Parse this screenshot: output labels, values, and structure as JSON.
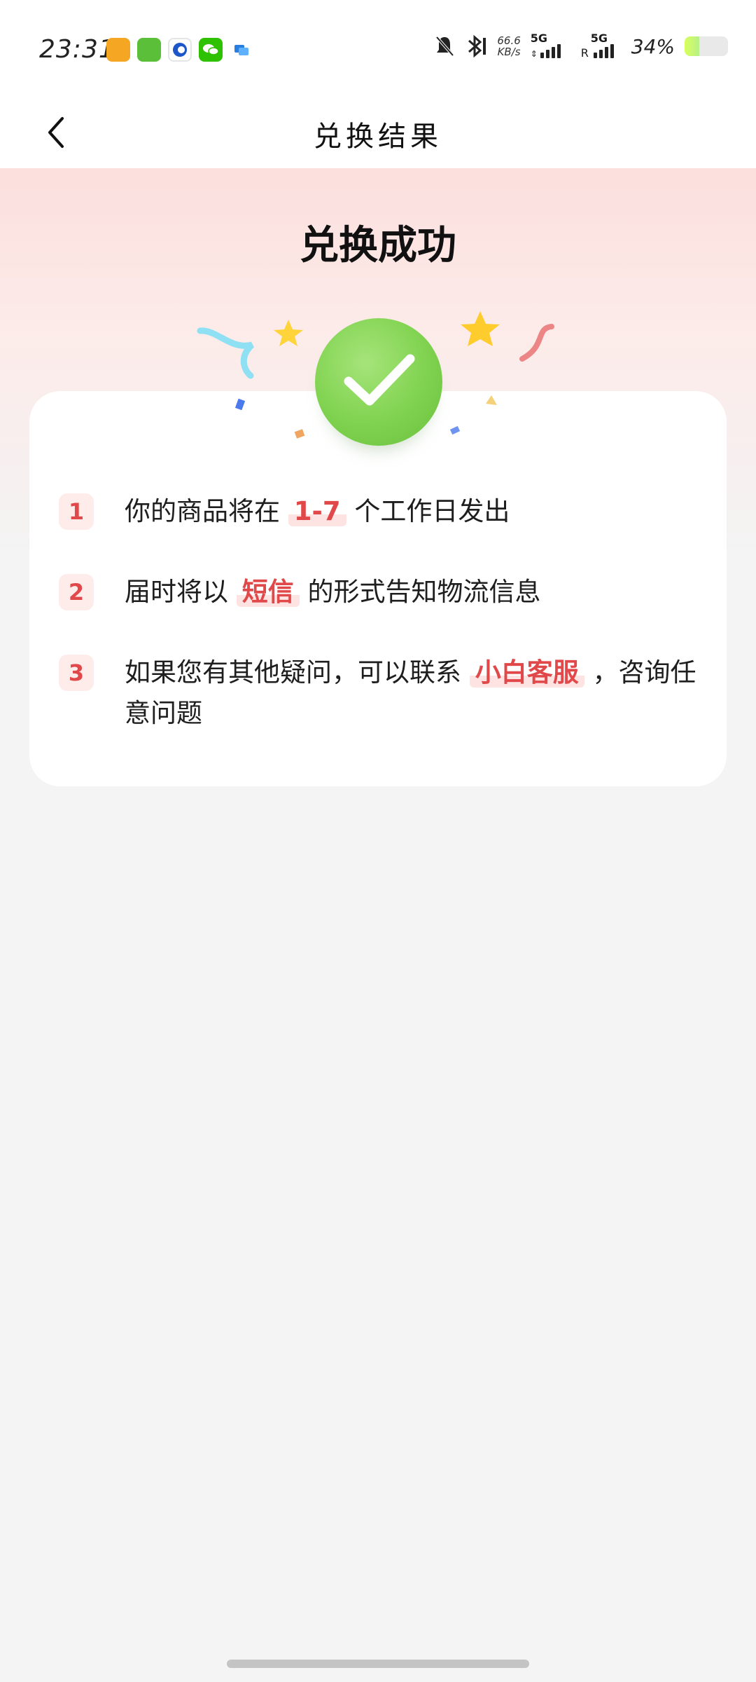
{
  "status_bar": {
    "time": "23:31",
    "net_speed_value": "66.6",
    "net_speed_unit": "KB/s",
    "signal1_label": "5G",
    "signal2_label": "5G",
    "signal2_roaming": "R",
    "battery_percent": "34%",
    "battery_level": 0.34,
    "app_icons": [
      "map-pin-app-icon",
      "group-buy-app-icon",
      "bank-app-icon",
      "wechat-icon",
      "message-app-icon"
    ]
  },
  "header": {
    "title": "兑换结果",
    "back_icon": "chevron-left-icon"
  },
  "hero": {
    "title": "兑换成功",
    "status_icon": "check-circle-icon",
    "accent_green": "#7fd24f"
  },
  "steps": [
    {
      "number": "1",
      "before": "你的商品将在",
      "highlight": "1-7",
      "after": "个工作日发出"
    },
    {
      "number": "2",
      "before": "届时将以",
      "highlight": "短信",
      "after": "的形式告知物流信息"
    },
    {
      "number": "3",
      "before": "如果您有其他疑问，可以联系",
      "highlight": "小白客服",
      "after": "，咨询任意问题"
    }
  ],
  "colors": {
    "accent_red": "#e0484a",
    "highlight_bg": "#fde3e1",
    "page_bg": "#f4f4f4"
  }
}
